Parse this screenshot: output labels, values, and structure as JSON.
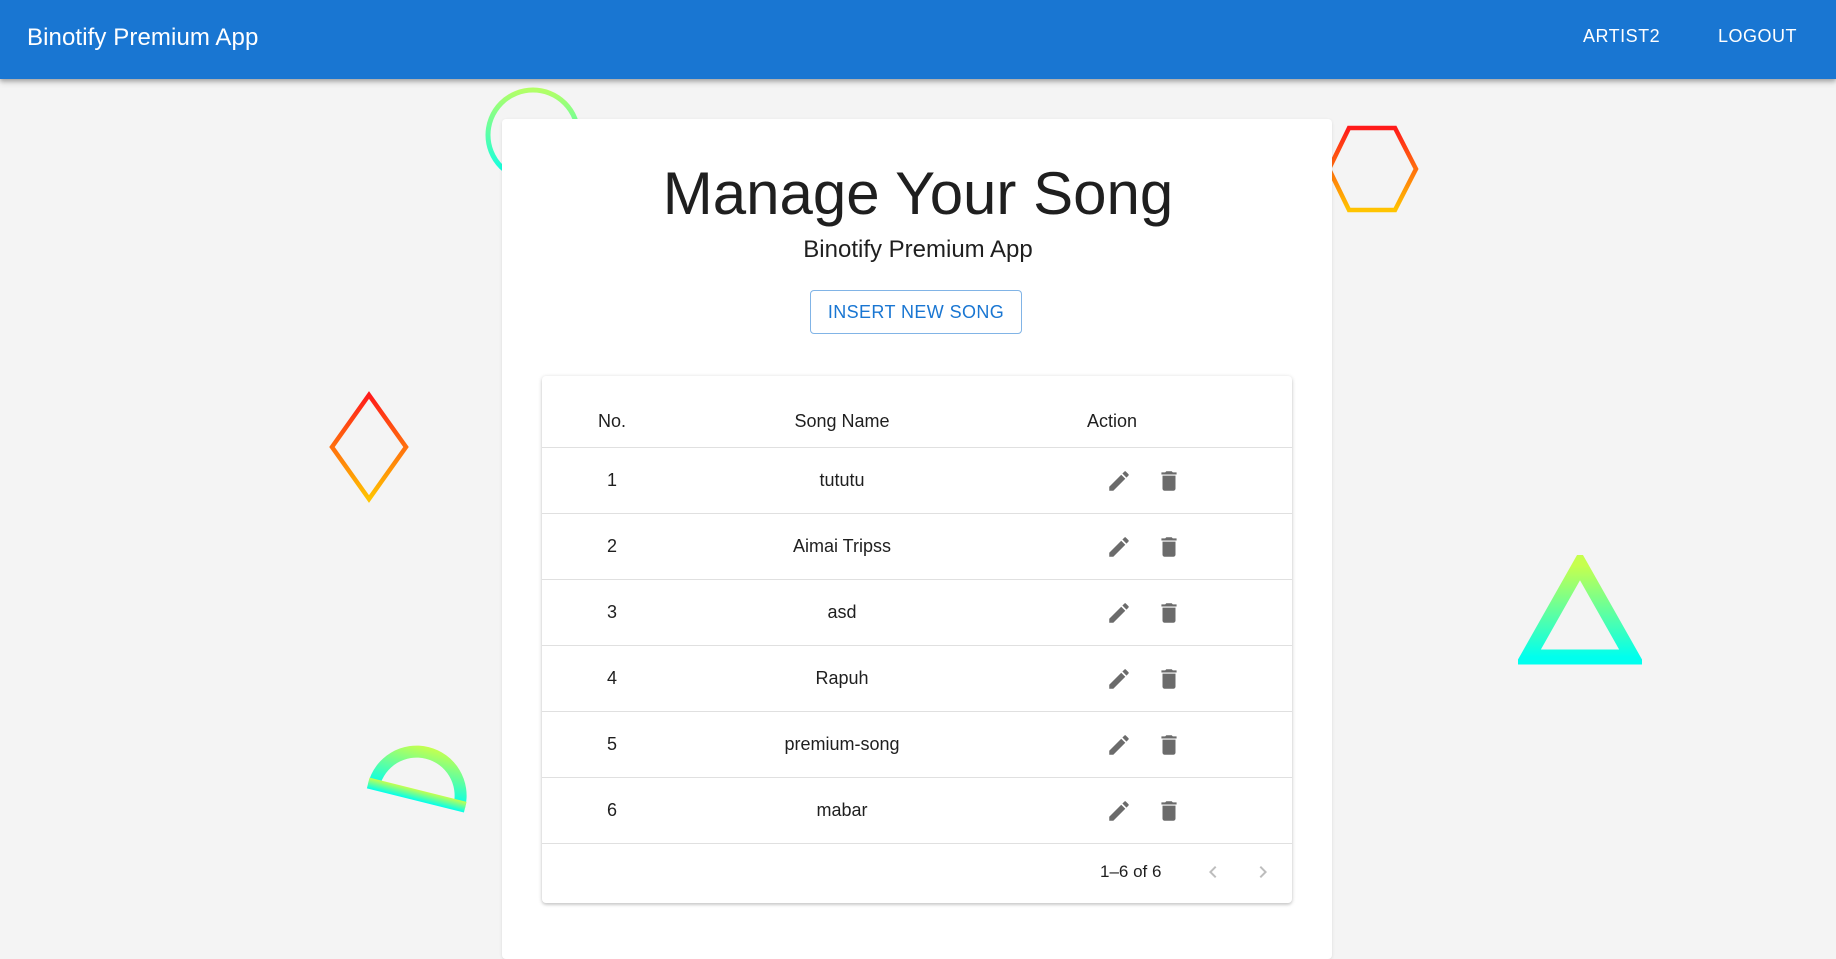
{
  "appbar": {
    "title": "Binotify Premium App",
    "nav": [
      {
        "label": "ARTIST2"
      },
      {
        "label": "LOGOUT"
      }
    ],
    "color": "#1976d2"
  },
  "main": {
    "title": "Manage Your Song",
    "subtitle": "Binotify Premium App",
    "insert_button_label": "INSERT NEW SONG"
  },
  "table": {
    "columns": [
      "No.",
      "Song Name",
      "Action"
    ],
    "rows": [
      {
        "no": "1",
        "name": "tututu"
      },
      {
        "no": "2",
        "name": "Aimai Tripss"
      },
      {
        "no": "3",
        "name": "asd"
      },
      {
        "no": "4",
        "name": "Rapuh"
      },
      {
        "no": "5",
        "name": "premium-song"
      },
      {
        "no": "6",
        "name": "mabar"
      }
    ],
    "row_actions": [
      "pencil-icon",
      "trash-icon"
    ],
    "pagination": {
      "info": "1–6 of 6",
      "prev_icon": "chevron-left-icon",
      "next_icon": "chevron-right-icon"
    }
  },
  "decorations": [
    "circle-ring-icon",
    "hexagon-icon",
    "diamond-icon",
    "triangle-icon",
    "semicircle-icon"
  ]
}
